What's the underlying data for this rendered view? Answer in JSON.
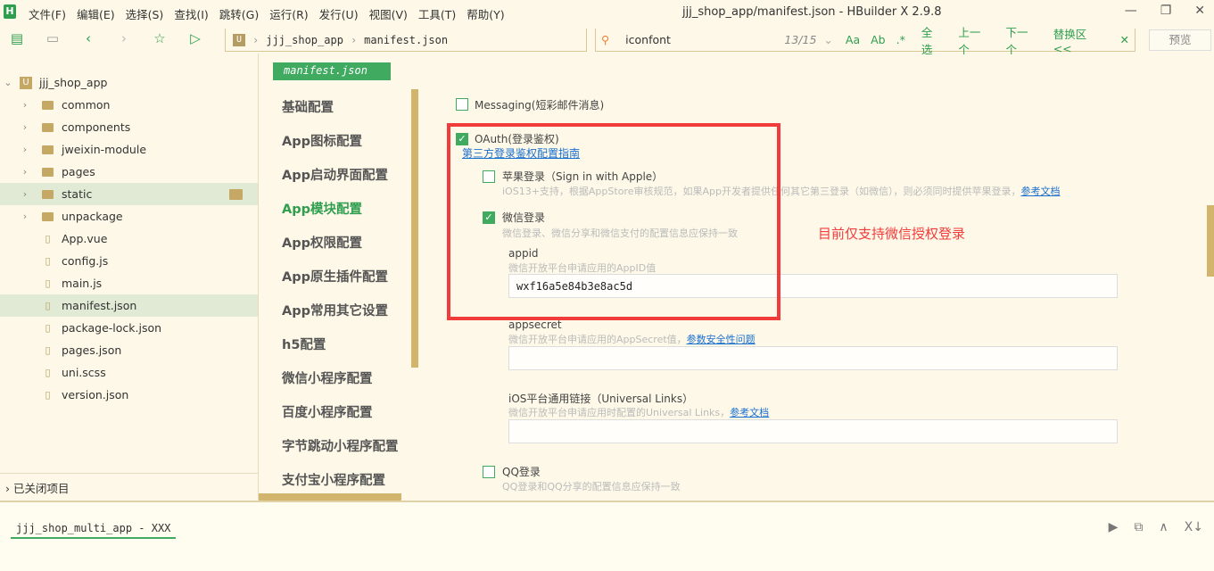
{
  "window": {
    "title": "jjj_shop_app/manifest.json - HBuilder X 2.9.8",
    "logo": "H"
  },
  "menu": [
    "文件(F)",
    "编辑(E)",
    "选择(S)",
    "查找(I)",
    "跳转(G)",
    "运行(R)",
    "发行(U)",
    "视图(V)",
    "工具(T)",
    "帮助(Y)"
  ],
  "breadcrumb": {
    "project": "jjj_shop_app",
    "file": "manifest.json"
  },
  "find": {
    "query": "iconfont",
    "count": "13/15",
    "select_all": "全选",
    "prev": "上一个",
    "next": "下一个",
    "replace": "替换区<<"
  },
  "preview_label": "预览",
  "sidebar": {
    "project": "jjj_shop_app",
    "items": [
      {
        "label": "common",
        "type": "folder"
      },
      {
        "label": "components",
        "type": "folder"
      },
      {
        "label": "jweixin-module",
        "type": "folder"
      },
      {
        "label": "pages",
        "type": "folder"
      },
      {
        "label": "static",
        "type": "folder",
        "selected": true
      },
      {
        "label": "unpackage",
        "type": "folder"
      },
      {
        "label": "App.vue",
        "type": "file"
      },
      {
        "label": "config.js",
        "type": "file"
      },
      {
        "label": "main.js",
        "type": "file"
      },
      {
        "label": "manifest.json",
        "type": "file",
        "selected": true
      },
      {
        "label": "package-lock.json",
        "type": "file"
      },
      {
        "label": "pages.json",
        "type": "file"
      },
      {
        "label": "uni.scss",
        "type": "file"
      },
      {
        "label": "version.json",
        "type": "file"
      }
    ],
    "closed_projects": "已关闭项目"
  },
  "editor_tab": "manifest.json",
  "config_nav": [
    "基础配置",
    "App图标配置",
    "App启动界面配置",
    "App模块配置",
    "App权限配置",
    "App原生插件配置",
    "App常用其它设置",
    "h5配置",
    "微信小程序配置",
    "百度小程序配置",
    "字节跳动小程序配置",
    "支付宝小程序配置"
  ],
  "config_nav_active": "App模块配置",
  "content": {
    "messaging": {
      "label": "Messaging(短彩邮件消息)",
      "checked": false
    },
    "oauth": {
      "label": "OAuth(登录鉴权)",
      "checked": true,
      "guide_link": "第三方登录鉴权配置指南"
    },
    "apple": {
      "label": "苹果登录（Sign in with Apple）",
      "checked": false,
      "hint": "iOS13+支持，根据AppStore审核规范，如果App开发者提供任何其它第三登录（如微信），则必须同时提供苹果登录，",
      "link": "参考文档"
    },
    "wechat": {
      "label": "微信登录",
      "checked": true,
      "hint": "微信登录、微信分享和微信支付的配置信息应保持一致"
    },
    "appid": {
      "label": "appid",
      "hint": "微信开放平台申请应用的AppID值",
      "value": "wxf16a5e84b3e8ac5d"
    },
    "appsecret": {
      "label": "appsecret",
      "hint": "微信开放平台申请应用的AppSecret值，",
      "link": "参数安全性问题",
      "value": ""
    },
    "universal": {
      "label": "iOS平台通用链接（Universal Links）",
      "hint": "微信开放平台申请应用时配置的Universal Links，",
      "link": "参考文档",
      "value": ""
    },
    "qq": {
      "label": "QQ登录",
      "checked": false,
      "hint": "QQ登录和QQ分享的配置信息应保持一致"
    }
  },
  "annotation": "目前仅支持微信授权登录",
  "terminal": {
    "tab": "jjj_shop_multi_app - XXX"
  },
  "colors": {
    "accent": "#3faa60",
    "annotation": "#f23b3b",
    "background": "#fdf8e7"
  }
}
